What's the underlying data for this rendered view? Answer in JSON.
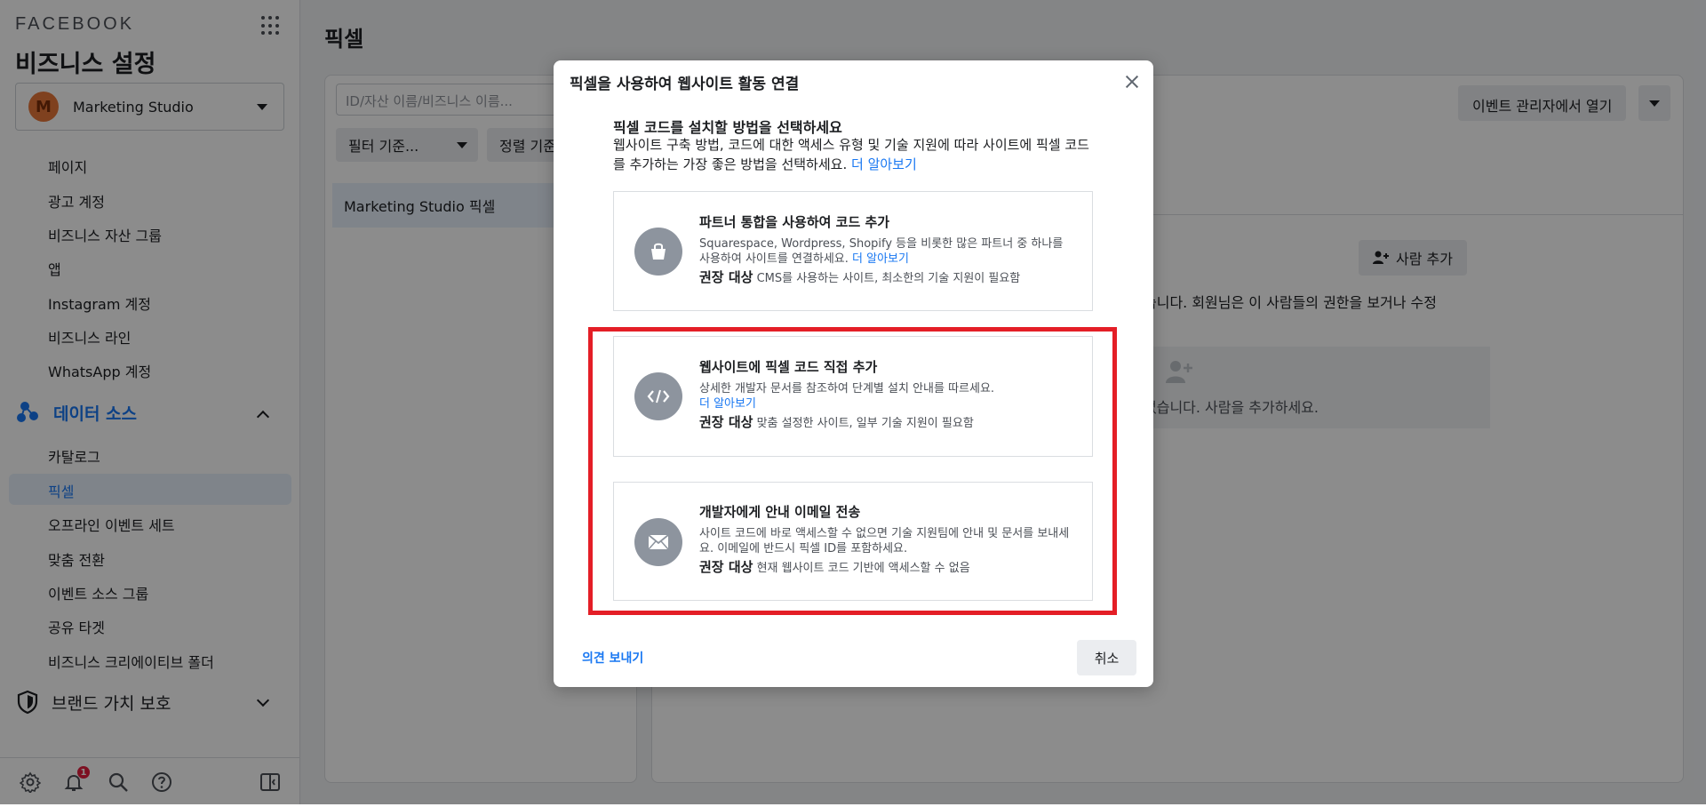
{
  "sidebar": {
    "brand": "FACEBOOK",
    "title": "비즈니스 설정",
    "account": {
      "initial": "M",
      "name": "Marketing Studio"
    },
    "accounts_items": [
      "페이지",
      "광고 계정",
      "비즈니스 자산 그룹",
      "앱",
      "Instagram 계정",
      "비즈니스 라인",
      "WhatsApp 계정"
    ],
    "data_sources_label": "데이터 소스",
    "data_items": [
      "카탈로그",
      "픽셀",
      "오프라인 이벤트 세트",
      "맞춤 전환",
      "이벤트 소스 그룹",
      "공유 타겟",
      "비즈니스 크리에이티브 폴더"
    ],
    "brand_safety_label": "브랜드 가치 보호",
    "notification_count": "1"
  },
  "main": {
    "page_title": "픽셀",
    "search_placeholder": "ID/자산 이름/비즈니스 이름...",
    "filter_label": "필터 기준...",
    "sort_label": "정렬 기준",
    "pixel_name": "Marketing Studio 픽셀",
    "event_manager_btn": "이벤트 관리자에서 열기",
    "add_person_btn": "사람 추가",
    "people_text": "습니다. 회원님은 이 사람들의 권한을 보거나 수정",
    "empty_text": "없습니다. 사람을 추가하세요."
  },
  "modal": {
    "title": "픽셀을 사용하여 웹사이트 활동 연결",
    "choose_heading": "픽셀 코드를 설치할 방법을 선택하세요",
    "choose_desc": "웹사이트 구축 방법, 코드에 대한 액세스 유형 및 기술 지원에 따라 사이트에 픽셀 코드를 추가하는 가장 좋은 방법을 선택하세요.",
    "learn_more": "더 알아보기",
    "recommended_label": "권장 대상",
    "options": [
      {
        "title": "파트너 통합을 사용하여 코드 추가",
        "desc": "Squarespace, Wordpress, Shopify 등을 비롯한 많은 파트너 중 하나를 사용하여 사이트를 연결하세요.",
        "learn_more": "더 알아보기",
        "rec": "CMS를 사용하는 사이트, 최소한의 기술 지원이 필요함"
      },
      {
        "title": "웹사이트에 픽셀 코드 직접 추가",
        "desc": "상세한 개발자 문서를 참조하여 단계별 설치 안내를 따르세요.",
        "learn_more": "더 알아보기",
        "rec": "맞춤 설정한 사이트, 일부 기술 지원이 필요함"
      },
      {
        "title": "개발자에게 안내 이메일 전송",
        "desc": "사이트 코드에 바로 액세스할 수 없으면 기술 지원팀에 안내 및 문서를 보내세요. 이메일에 반드시 픽셀 ID를 포함하세요.",
        "rec": "현재 웹사이트 코드 기반에 액세스할 수 없음"
      }
    ],
    "feedback": "의견 보내기",
    "cancel": "취소"
  },
  "colors": {
    "accent": "#1877f2",
    "highlight": "#e41e26",
    "badge": "#e41e3f"
  }
}
